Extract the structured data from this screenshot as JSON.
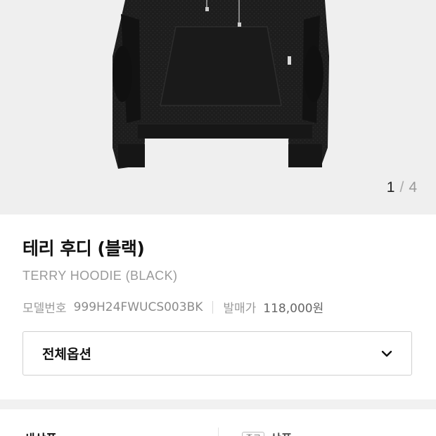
{
  "gallery": {
    "current": "1",
    "separator": "/",
    "total": "4"
  },
  "product": {
    "name_ko": "테리 후디 (블랙)",
    "name_en": "TERRY HOODIE (BLACK)",
    "model_label": "모델번호",
    "model_number": "999H24FWUCS003BK",
    "release_label": "발매가",
    "release_price": "118,000원"
  },
  "options": {
    "label": "전체옵션"
  },
  "tabs": {
    "new_label": "새상품",
    "used_badge": "중고",
    "used_label": "상품"
  },
  "colors": {
    "gallery_bg": "#efefef",
    "band_bg": "#f1f1f1",
    "garment": "#1c1c1c"
  },
  "icons": {
    "option_toggle": "chevron-down-icon"
  }
}
